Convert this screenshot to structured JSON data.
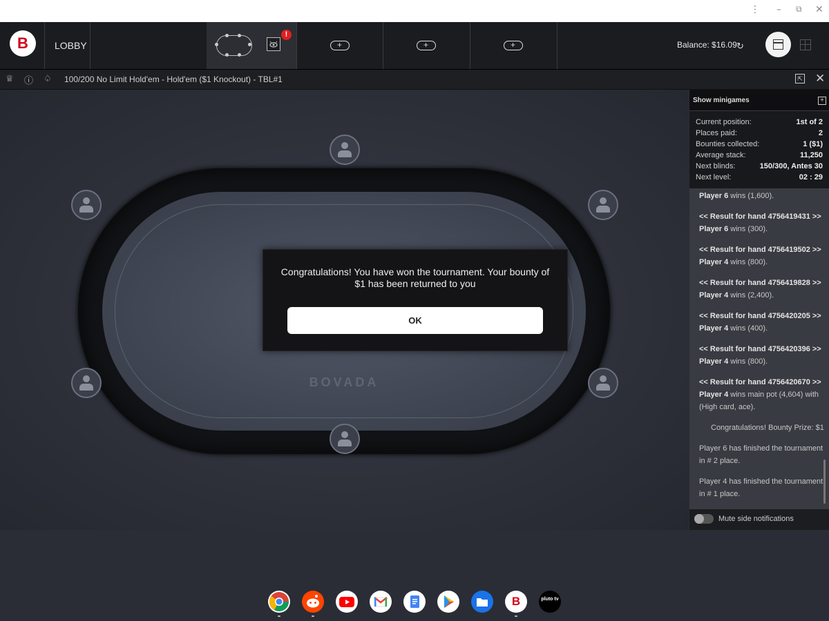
{
  "window_controls": {
    "menu": "⋮",
    "minimize": "–",
    "restore": "⧉",
    "close": "✕"
  },
  "topbar": {
    "logo_letter": "B",
    "lobby_label": "LOBBY",
    "alert_badge": "!",
    "add_tab_icon": "+",
    "balance": "Balance: $16.09",
    "cashier_icon": "↻"
  },
  "infobar": {
    "trophy_icon": "♕",
    "info_icon": "ⓘ",
    "cards_icon": "♤",
    "table_title": "100/200 No Limit Hold'em - Hold'em ($1 Knockout) - TBL#1",
    "popout_icon": "⇱",
    "close_icon": "✕"
  },
  "table": {
    "brand": "BOVADA"
  },
  "modal": {
    "message": "Congratulations! You have won the tournament. Your bounty of $1 has been returned to you",
    "ok_label": "OK"
  },
  "side": {
    "minigames_label": "Show minigames",
    "minigames_icon": "+",
    "stats": [
      {
        "label": "Current position:",
        "value": "1st of 2"
      },
      {
        "label": "Places paid:",
        "value": "2"
      },
      {
        "label": "Bounties collected:",
        "value": "1 ($1)"
      },
      {
        "label": "Average stack:",
        "value": "11,250"
      },
      {
        "label": "Next blinds:",
        "value": "150/300, Antes 30"
      },
      {
        "label": "Next level:",
        "value": "02 : 29"
      }
    ],
    "log": [
      {
        "player": "Player 6",
        "text": " wins (1,600)."
      },
      {
        "hand": "<< Result for hand 4756419431 >>"
      },
      {
        "player": "Player 6",
        "text": " wins (300)."
      },
      {
        "hand": "<< Result for hand 4756419502 >>"
      },
      {
        "player": "Player 4",
        "text": " wins (800)."
      },
      {
        "hand": "<< Result for hand 4756419828 >>"
      },
      {
        "player": "Player 4",
        "text": " wins (2,400)."
      },
      {
        "hand": "<< Result for hand 4756420205 >>"
      },
      {
        "player": "Player 4",
        "text": " wins (400)."
      },
      {
        "hand": "<< Result for hand 4756420396 >>"
      },
      {
        "player": "Player 4",
        "text": " wins (800)."
      },
      {
        "hand": "<< Result for hand 4756420670 >>"
      },
      {
        "player": "Player 4",
        "text": " wins main pot (4,604) with"
      },
      {
        "plain": "(High card, ace)."
      },
      {
        "plain": "Congratulations! Bounty Prize: $1"
      },
      {
        "plain": "Player 6 has finished the tournament"
      },
      {
        "plain": "in # 2 place."
      },
      {
        "plain": "Player 4 has finished the tournament"
      },
      {
        "plain": "in # 1 place."
      }
    ],
    "mute_label": "Mute side notifications"
  },
  "shelf": [
    {
      "name": "chrome",
      "label": "",
      "color": "#ffffff"
    },
    {
      "name": "reddit",
      "label": "",
      "color": "#ff4500"
    },
    {
      "name": "youtube",
      "label": "",
      "color": "#ffffff"
    },
    {
      "name": "gmail",
      "label": "",
      "color": "#ffffff"
    },
    {
      "name": "docs",
      "label": "",
      "color": "#ffffff"
    },
    {
      "name": "play-store",
      "label": "",
      "color": "#ffffff"
    },
    {
      "name": "files",
      "label": "",
      "color": "#1a73e8"
    },
    {
      "name": "bovada",
      "label": "B",
      "color": "#ffffff"
    },
    {
      "name": "pluto-tv",
      "label": "pluto tv",
      "color": "#000000"
    }
  ]
}
